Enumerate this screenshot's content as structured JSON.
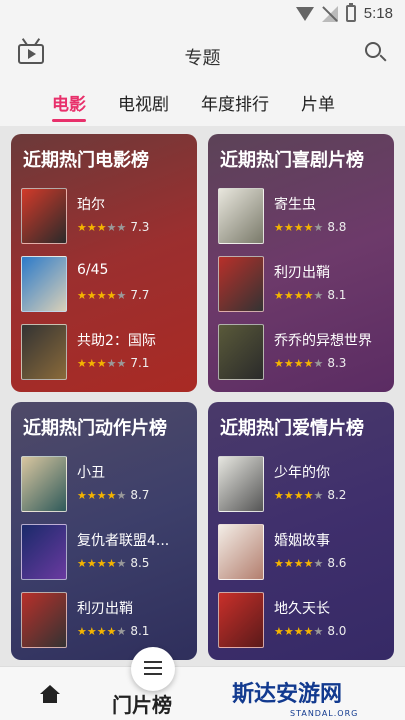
{
  "status": {
    "time": "5:18"
  },
  "appbar": {
    "title": "专题"
  },
  "tabs": [
    "电影",
    "电视剧",
    "年度排行",
    "片单"
  ],
  "cards": [
    {
      "title": "近期热门电影榜",
      "movies": [
        {
          "name": "珀尔",
          "score": "7.3",
          "stars": 3.5
        },
        {
          "name": "6/45",
          "score": "7.7",
          "stars": 4
        },
        {
          "name": "共助2：国际",
          "score": "7.1",
          "stars": 3.5
        }
      ]
    },
    {
      "title": "近期热门喜剧片榜",
      "movies": [
        {
          "name": "寄生虫",
          "score": "8.8",
          "stars": 4.5
        },
        {
          "name": "利刃出鞘",
          "score": "8.1",
          "stars": 4
        },
        {
          "name": "乔乔的异想世界",
          "score": "8.3",
          "stars": 4
        }
      ]
    },
    {
      "title": "近期热门动作片榜",
      "movies": [
        {
          "name": "小丑",
          "score": "8.7",
          "stars": 4.5
        },
        {
          "name": "复仇者联盟4...",
          "score": "8.5",
          "stars": 4
        },
        {
          "name": "利刃出鞘",
          "score": "8.1",
          "stars": 4
        }
      ]
    },
    {
      "title": "近期热门爱情片榜",
      "movies": [
        {
          "name": "少年的你",
          "score": "8.2",
          "stars": 4
        },
        {
          "name": "婚姻故事",
          "score": "8.6",
          "stars": 4
        },
        {
          "name": "地久天长",
          "score": "8.0",
          "stars": 4
        }
      ]
    }
  ],
  "bottom": {
    "partial_text": "门片榜"
  },
  "watermark": {
    "text": "斯达安游网",
    "sub": "STANDAL.ORG"
  }
}
